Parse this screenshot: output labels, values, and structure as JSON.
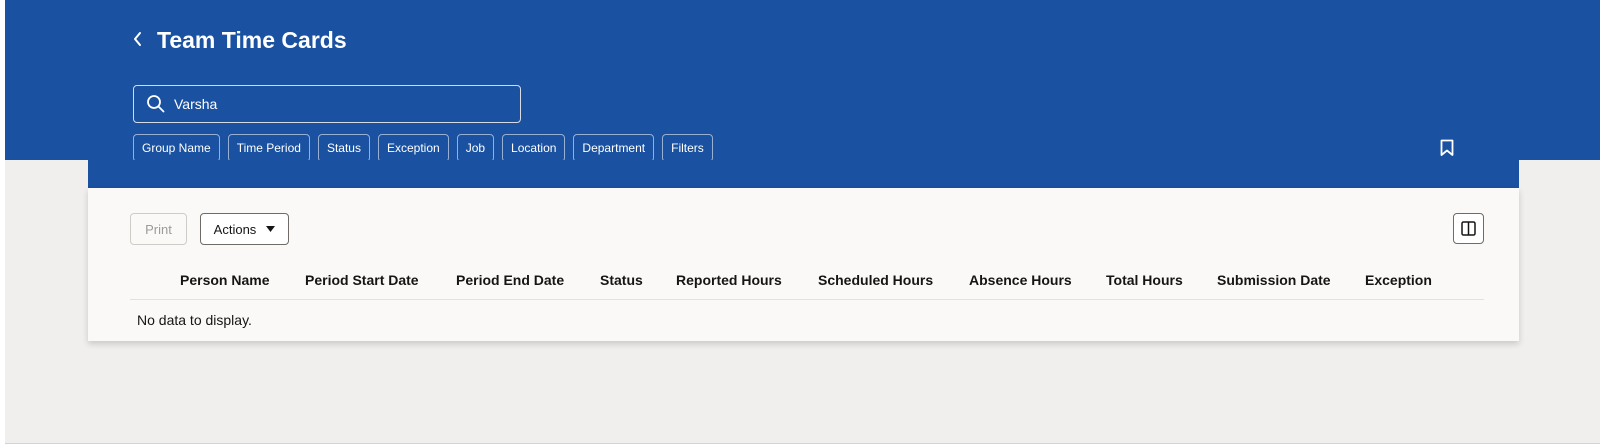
{
  "header": {
    "title": "Team Time Cards",
    "back_icon": "chevron-left-icon",
    "bookmark_icon": "bookmark-icon",
    "background_color": "#1a51a0"
  },
  "search": {
    "value": "Varsha",
    "icon": "search-icon"
  },
  "filter_chips": [
    "Group Name",
    "Time Period",
    "Status",
    "Exception",
    "Job",
    "Location",
    "Department",
    "Filters"
  ],
  "toolbar": {
    "print_label": "Print",
    "actions_label": "Actions",
    "columns_icon": "columns-icon"
  },
  "table": {
    "columns": [
      "Person Name",
      "Period Start Date",
      "Period End Date",
      "Status",
      "Reported Hours",
      "Scheduled Hours",
      "Absence Hours",
      "Total Hours",
      "Submission Date",
      "Exception"
    ],
    "empty_message": "No data to display."
  }
}
